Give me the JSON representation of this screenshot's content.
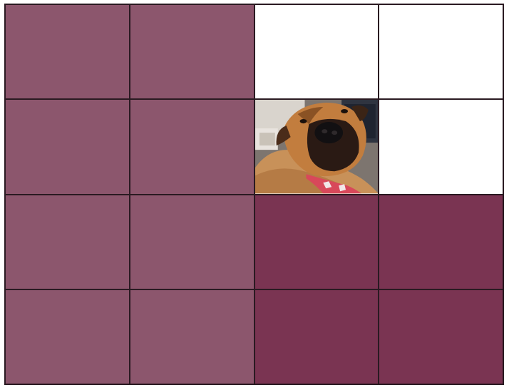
{
  "grid": {
    "rows": 4,
    "cols": 4,
    "colors": {
      "light_tile": "#8c566d",
      "dark_tile": "#7a3452",
      "empty_tile": "#ffffff",
      "grid_line": "#2a1a22"
    },
    "tiles": [
      [
        "light",
        "light",
        "empty",
        "empty"
      ],
      [
        "light",
        "light",
        "photo",
        "empty"
      ],
      [
        "light",
        "light",
        "dark",
        "dark"
      ],
      [
        "light",
        "light",
        "dark",
        "dark"
      ]
    ],
    "photo_tile": {
      "row": 2,
      "col": 3,
      "icon": "dog-photo-icon"
    }
  }
}
